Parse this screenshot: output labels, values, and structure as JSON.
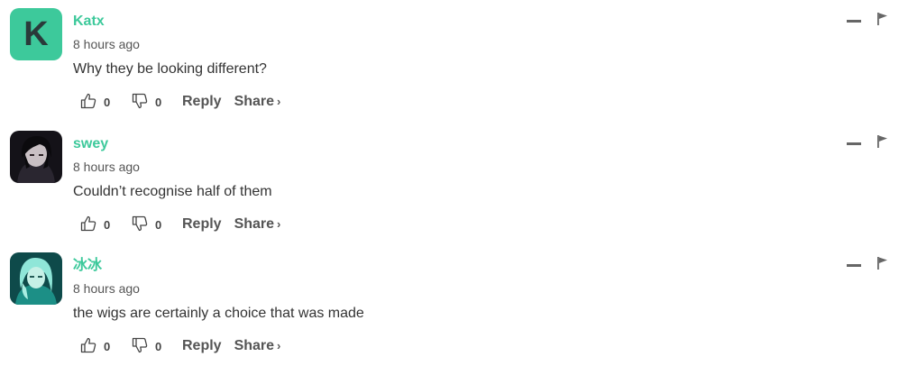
{
  "colors": {
    "accent": "#3dc99b",
    "text": "#333333",
    "muted": "#555555"
  },
  "comments": [
    {
      "avatar_letter": "K",
      "username": "Katx",
      "time": "8 hours ago",
      "text": "Why they be looking different?",
      "upvotes": "0",
      "downvotes": "0",
      "reply_label": "Reply",
      "share_label": "Share",
      "share_chevron": "›"
    },
    {
      "username": "swey",
      "time": "8 hours ago",
      "text": "Couldn’t recognise half of them",
      "upvotes": "0",
      "downvotes": "0",
      "reply_label": "Reply",
      "share_label": "Share",
      "share_chevron": "›"
    },
    {
      "username": "冰冰",
      "time": "8 hours ago",
      "text": "the wigs are certainly a choice that was made",
      "upvotes": "0",
      "downvotes": "0",
      "reply_label": "Reply",
      "share_label": "Share",
      "share_chevron": "›"
    }
  ]
}
